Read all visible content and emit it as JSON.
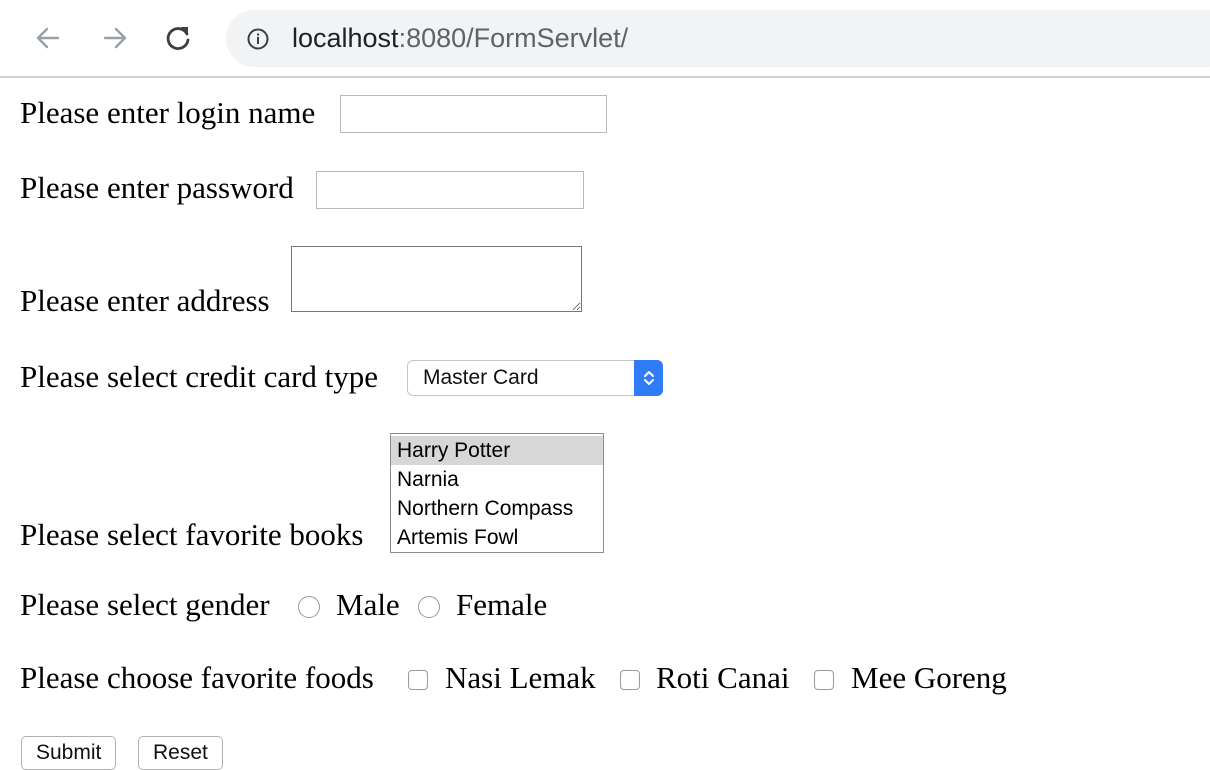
{
  "browser": {
    "url_host": "localhost",
    "url_rest": ":8080/FormServlet/"
  },
  "form": {
    "login_label": "Please enter login name",
    "login_value": "",
    "password_label": "Please enter password",
    "password_value": "",
    "address_label": "Please enter address",
    "address_value": "",
    "card_label": "Please select credit card type",
    "card_selected": "Master Card",
    "books_label": "Please select favorite books",
    "books": [
      {
        "label": "Harry Potter",
        "selected": true
      },
      {
        "label": "Narnia",
        "selected": false
      },
      {
        "label": "Northern Compass",
        "selected": false
      },
      {
        "label": "Artemis Fowl",
        "selected": false
      }
    ],
    "gender_label": "Please select gender",
    "gender_options": [
      "Male",
      "Female"
    ],
    "foods_label": "Please choose favorite foods",
    "foods": [
      "Nasi Lemak",
      "Roti Canai",
      "Mee Goreng"
    ],
    "submit_label": "Submit",
    "reset_label": "Reset"
  },
  "colors": {
    "select_accent": "#2f7cf6",
    "listbox_selected": "#d7d7d7",
    "omnibox_bg": "#f1f3f4"
  },
  "icons": {
    "back": "arrow-left-icon",
    "forward": "arrow-right-icon",
    "reload": "reload-icon",
    "site_info": "info-icon",
    "select": "updown-chevron-icon"
  }
}
